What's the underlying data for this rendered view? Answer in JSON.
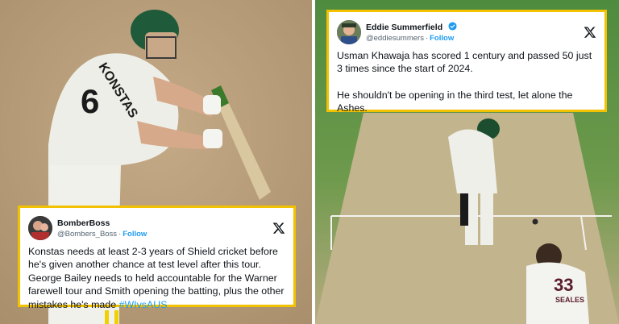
{
  "left_tweet": {
    "display_name": "BomberBoss",
    "handle": "@Bombers_Boss",
    "follow_label": "Follow",
    "body": "Konstas needs at least 2-3 years of Shield cricket before he's given another chance at test level after this tour. George Bailey needs to held accountable for the Warner farewell tour and Smith opening the batting, plus the other mistakes he's made",
    "hashtag": "#WIvsAUS",
    "verified": false
  },
  "right_tweet": {
    "display_name": "Eddie Summerfield",
    "handle": "@eddiesummers",
    "follow_label": "Follow",
    "paragraph_1": "Usman Khawaja has scored 1 century and passed 50 just 3 times since the start of 2024.",
    "paragraph_2": "He shouldn't be opening in the third test, let alone the Ashes.",
    "verified": true
  },
  "left_photo": {
    "jersey_name": "KONSTAS",
    "jersey_number": "6"
  },
  "right_photo": {
    "bowler_name": "SEALES",
    "bowler_number": "33"
  },
  "icons": {
    "platform": "x-logo-icon",
    "verified": "verified-badge-icon"
  },
  "colors": {
    "card_border": "#f2c200",
    "link": "#1d9bf0",
    "handle": "#536471",
    "verified": "#1d9bf0"
  }
}
